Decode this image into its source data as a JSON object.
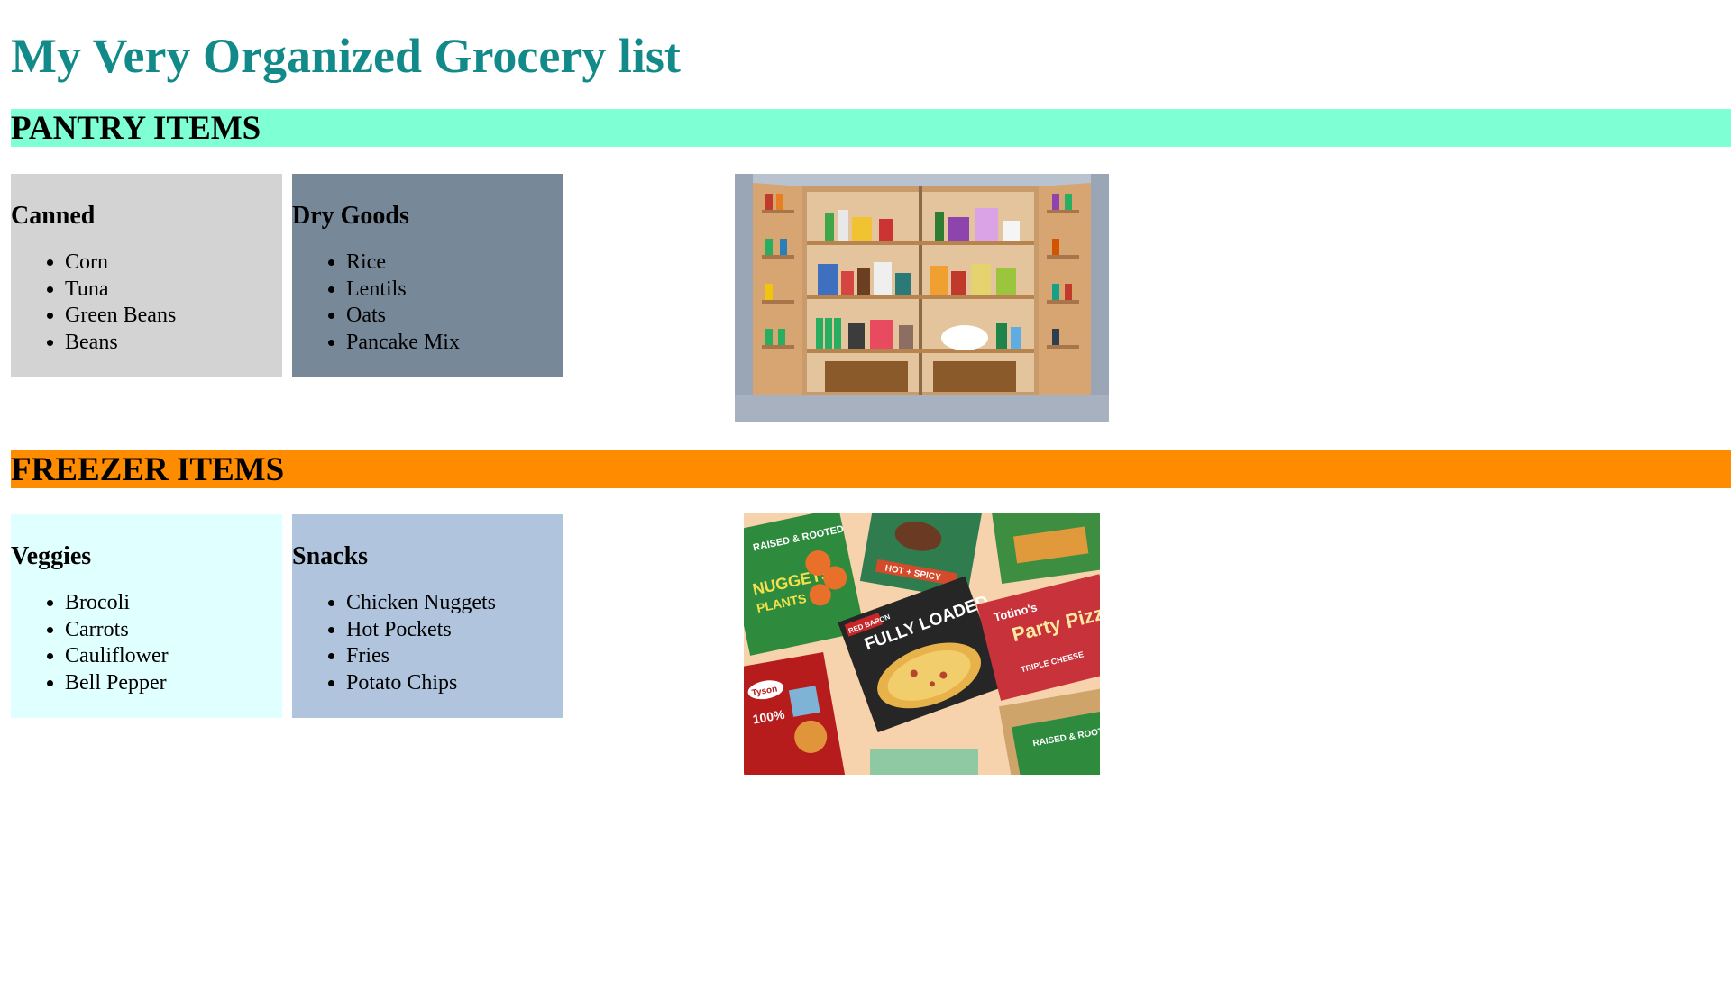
{
  "page": {
    "title": "My Very Organized Grocery list",
    "title_color": "#138a8a"
  },
  "sections": [
    {
      "heading": "PANTRY ITEMS",
      "bar_color": "#7fffd4",
      "cards": [
        {
          "title": "Canned",
          "bg": "#d3d3d3",
          "items": [
            "Corn",
            "Tuna",
            "Green Beans",
            "Beans"
          ]
        },
        {
          "title": "Dry Goods",
          "bg": "#778899",
          "items": [
            "Rice",
            "Lentils",
            "Oats",
            "Pancake Mix"
          ]
        }
      ],
      "image": {
        "subject": "open pantry cabinet with shelves of food"
      }
    },
    {
      "heading": "FREEZER ITEMS",
      "bar_color": "#ff8c00",
      "cards": [
        {
          "title": "Veggies",
          "bg": "#e0ffff",
          "items": [
            "Brocoli",
            "Carrots",
            "Cauliflower",
            "Bell Pepper"
          ]
        },
        {
          "title": "Snacks",
          "bg": "#b0c4de",
          "items": [
            "Chicken Nuggets",
            "Hot Pockets",
            "Fries",
            "Potato Chips"
          ]
        }
      ],
      "image": {
        "subject": "assortment of frozen food packages",
        "package_text": [
          "RAISED & ROOTED",
          "NUGGETS",
          "PLANTS",
          "HOT + SPICY",
          "RED BARON",
          "FULLY LOADED",
          "Totino's",
          "Party Pizza",
          "TRIPLE CHEESE",
          "Tyson",
          "100%"
        ]
      }
    }
  ]
}
